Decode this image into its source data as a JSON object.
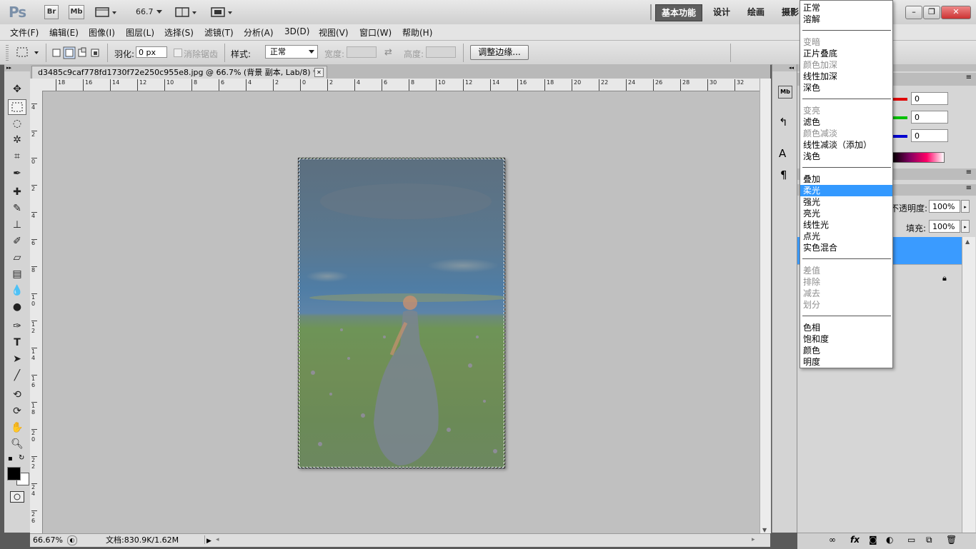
{
  "titlebar": {
    "logo": "Ps",
    "bridge": "Br",
    "minibridge": "Mb",
    "zoom": "66.7",
    "workspaces": [
      "基本功能",
      "设计",
      "绘画",
      "摄影"
    ],
    "win_min": "–",
    "win_restore": "❐",
    "win_close": "✕"
  },
  "menubar": {
    "items": [
      "文件(F)",
      "编辑(E)",
      "图像(I)",
      "图层(L)",
      "选择(S)",
      "滤镜(T)",
      "分析(A)",
      "3D(D)",
      "视图(V)",
      "窗口(W)",
      "帮助(H)"
    ]
  },
  "options": {
    "feather_label": "羽化:",
    "feather_value": "0 px",
    "antialias_label": "消除锯齿",
    "style_label": "样式:",
    "style_value": "正常",
    "width_label": "宽度:",
    "height_label": "高度:",
    "refine_button": "调整边缘..."
  },
  "document": {
    "tab_title": "d3485c9caf778fd1730f72e250c955e8.jpg @ 66.7% (背景 副本, Lab/8) *",
    "close": "✕"
  },
  "ruler": {
    "h_labels": [
      "18",
      "16",
      "14",
      "12",
      "10",
      "8",
      "6",
      "4",
      "2",
      "0",
      "2",
      "4",
      "6",
      "8",
      "10",
      "12",
      "14",
      "16",
      "18",
      "20",
      "22",
      "24",
      "26",
      "28",
      "30",
      "32"
    ],
    "v_labels": [
      "4",
      "2",
      "0",
      "2",
      "4",
      "6",
      "8",
      "10",
      "12",
      "14",
      "16",
      "18",
      "20",
      "22",
      "24",
      "26"
    ]
  },
  "status": {
    "zoom": "66.67%",
    "doc_info": "文档:830.9K/1.62M"
  },
  "panels": {
    "color_values": [
      "0",
      "0",
      "0"
    ],
    "opacity_label": "不透明度:",
    "opacity_value": "100%",
    "fill_label": "填充:",
    "fill_value": "100%"
  },
  "blend_menu": {
    "groups": [
      [
        {
          "label": "正常",
          "dim": false
        },
        {
          "label": "溶解",
          "dim": false
        }
      ],
      [
        {
          "label": "变暗",
          "dim": true
        },
        {
          "label": "正片叠底",
          "dim": false
        },
        {
          "label": "颜色加深",
          "dim": true
        },
        {
          "label": "线性加深",
          "dim": false
        },
        {
          "label": "深色",
          "dim": false
        }
      ],
      [
        {
          "label": "变亮",
          "dim": true
        },
        {
          "label": "滤色",
          "dim": false
        },
        {
          "label": "颜色减淡",
          "dim": true
        },
        {
          "label": "线性减淡（添加）",
          "dim": false
        },
        {
          "label": "浅色",
          "dim": false
        }
      ],
      [
        {
          "label": "叠加",
          "dim": false
        },
        {
          "label": "柔光",
          "dim": false,
          "selected": true
        },
        {
          "label": "强光",
          "dim": false
        },
        {
          "label": "亮光",
          "dim": false
        },
        {
          "label": "线性光",
          "dim": false
        },
        {
          "label": "点光",
          "dim": false
        },
        {
          "label": "实色混合",
          "dim": false
        }
      ],
      [
        {
          "label": "差值",
          "dim": true
        },
        {
          "label": "排除",
          "dim": true
        },
        {
          "label": "减去",
          "dim": true
        },
        {
          "label": "划分",
          "dim": true
        }
      ],
      [
        {
          "label": "色相",
          "dim": false
        },
        {
          "label": "饱和度",
          "dim": false
        },
        {
          "label": "颜色",
          "dim": false
        },
        {
          "label": "明度",
          "dim": false
        }
      ]
    ]
  },
  "colors": {
    "selection_blue": "#3399ff",
    "red_slider": "#e00000",
    "green_slider": "#00c000",
    "blue_slider": "#0000d0"
  }
}
